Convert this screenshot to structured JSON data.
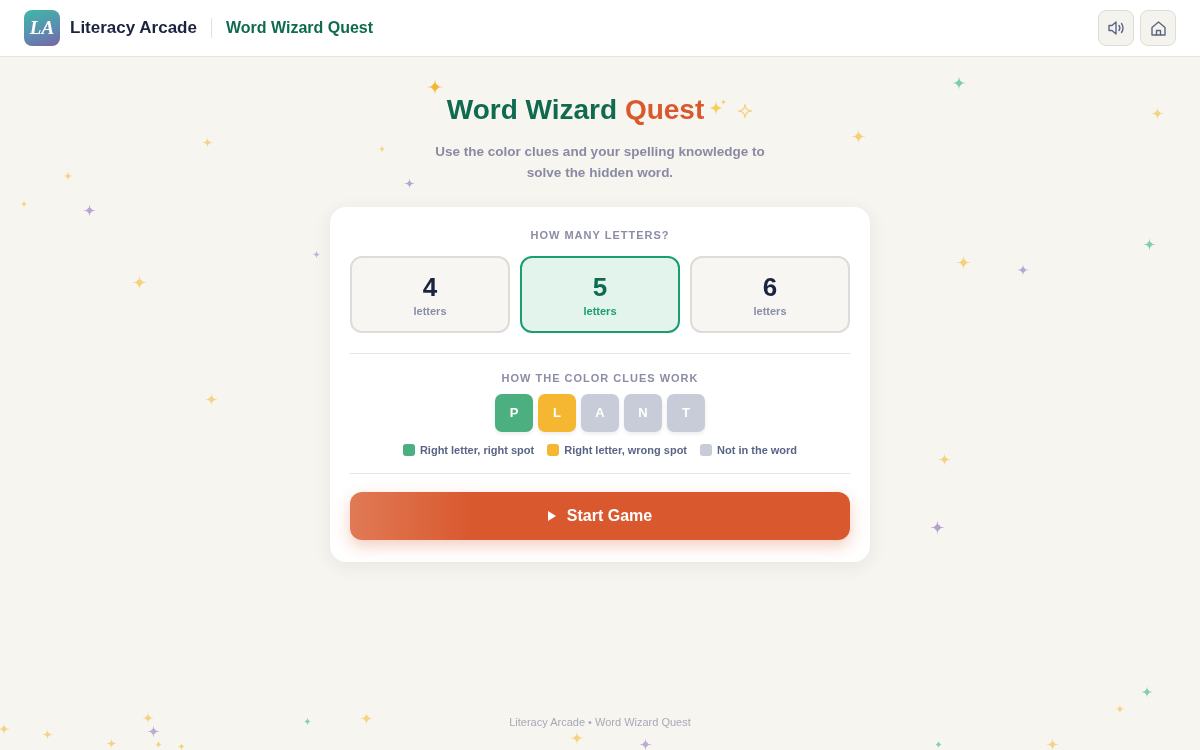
{
  "header": {
    "logo_text": "LA",
    "brand": "Literacy Arcade",
    "game_title": "Word Wizard Quest"
  },
  "hero": {
    "title": "Word Wizard",
    "title_accent": "Quest",
    "subtitle": "Use the color clues and your spelling knowledge to solve the hidden word."
  },
  "letter_picker": {
    "label": "HOW MANY LETTERS?",
    "options": [
      {
        "count": "4",
        "unit": "letters",
        "selected": false
      },
      {
        "count": "5",
        "unit": "letters",
        "selected": true
      },
      {
        "count": "6",
        "unit": "letters",
        "selected": false
      }
    ]
  },
  "clues": {
    "label": "HOW THE COLOR CLUES WORK",
    "tiles": [
      {
        "letter": "P",
        "color": "#4caf80"
      },
      {
        "letter": "L",
        "color": "#f5b731"
      },
      {
        "letter": "A",
        "color": "#c8ccd8"
      },
      {
        "letter": "N",
        "color": "#c8ccd8"
      },
      {
        "letter": "T",
        "color": "#c8ccd8"
      }
    ],
    "legend": [
      {
        "text": "Right letter, right spot",
        "color": "#4caf80"
      },
      {
        "text": "Right letter, wrong spot",
        "color": "#f5b731"
      },
      {
        "text": "Not in the word",
        "color": "#c8ccd8"
      }
    ]
  },
  "start_button": "Start Game",
  "footer": "Literacy Arcade • Word Wizard Quest"
}
